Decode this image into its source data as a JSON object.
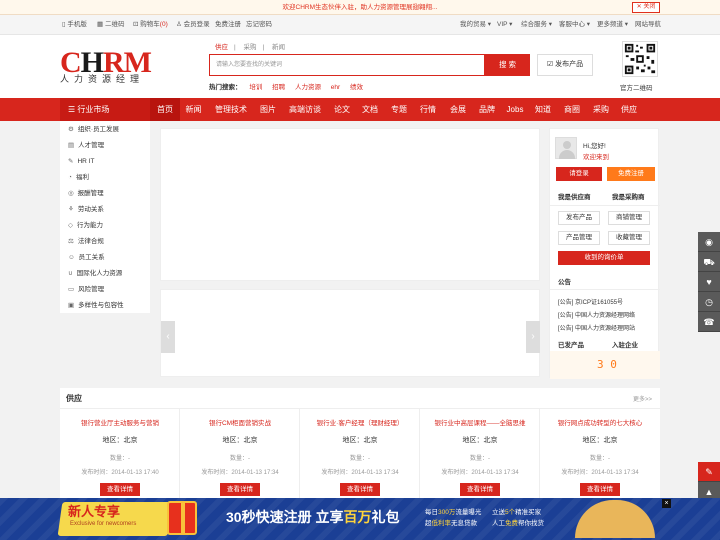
{
  "notice": {
    "text": "欢迎CHRM生态伙伴入驻，助人力资源管理展翅翱翔...",
    "close": "关闭"
  },
  "toolbar": {
    "left": [
      "手机版",
      "二维码",
      "购物车",
      "0",
      "会员登录",
      "免费注册",
      "忘记密码"
    ],
    "right": [
      "我的贸易 ▾",
      "VIP ▾",
      "综合服务 ▾",
      "客服中心 ▾",
      "更多频道 ▾",
      "网站导航"
    ]
  },
  "logo": {
    "big1": "C",
    "big2": "H",
    "big3": "RM",
    "sub": "人力资源经理"
  },
  "search": {
    "tabs": [
      "供应",
      "采购",
      "新闻"
    ],
    "placeholder": "请输入您要查找的关键词",
    "button": "搜 索",
    "publish": "发布产品",
    "hot_label": "热门搜索：",
    "hot": [
      "培训",
      "招聘",
      "人力资源",
      "ehr",
      "绩效"
    ]
  },
  "qr_label": "官方二维码",
  "nav": {
    "market": "行业市场",
    "items": [
      "首页",
      "新闻",
      "管理技术",
      "图片",
      "高端访谈",
      "论文",
      "文档",
      "专题",
      "行情",
      "会展",
      "品牌",
      "Jobs",
      "知道",
      "商圈",
      "采购",
      "供应"
    ]
  },
  "sidebar": [
    {
      "icon": "⚙",
      "label": "组织·员工发展"
    },
    {
      "icon": "▤",
      "label": "人才管理"
    },
    {
      "icon": "✎",
      "label": "HR IT"
    },
    {
      "icon": "◔",
      "label": "福利"
    },
    {
      "icon": "◎",
      "label": "报酬管理"
    },
    {
      "icon": "⚘",
      "label": "劳动关系"
    },
    {
      "icon": "◇",
      "label": "行为能力"
    },
    {
      "icon": "⚖",
      "label": "法律合规"
    },
    {
      "icon": "☺",
      "label": "员工关系"
    },
    {
      "icon": "∪",
      "label": "国际化人力资源"
    },
    {
      "icon": "▭",
      "label": "风险管理"
    },
    {
      "icon": "▣",
      "label": "多样性与包容性"
    }
  ],
  "user": {
    "hello": "Hi,您好!",
    "welcome": "欢迎来到",
    "login": "请登录",
    "register": "免费注册",
    "tab_seller": "我是供应商",
    "tab_buyer": "我是采购商",
    "btn1": "发布产品",
    "btn2": "商铺管理",
    "btn3": "产品管理",
    "btn4": "收藏管理",
    "inquiry": "收到的询价单",
    "notice_title": "公告",
    "notices": [
      "[公告] 京ICP证161055号",
      "[公告] 中国人力资源经理网络",
      "[公告] 中国人力资源经理网站"
    ],
    "stat1": "已发产品",
    "stat2": "入驻企业",
    "count": "3 0"
  },
  "supply": {
    "title": "供应",
    "more": "更多>>",
    "items": [
      {
        "title": "银行营业厅主动服务与营销",
        "area": "地区：北京",
        "qty": "数量：-",
        "date": "发布时间：2014-01-13 17:40",
        "btn": "查看详情"
      },
      {
        "title": "银行CM柜面营销实战",
        "area": "地区：北京",
        "qty": "数量：-",
        "date": "发布时间：2014-01-13 17:34",
        "btn": "查看详情"
      },
      {
        "title": "银行业·客户经理（理财经理）",
        "area": "地区：北京",
        "qty": "数量：-",
        "date": "发布时间：2014-01-13 17:34",
        "btn": "查看详情"
      },
      {
        "title": "银行业中高层课程——全脑思维",
        "area": "地区：北京",
        "qty": "数量：-",
        "date": "发布时间：2014-01-13 17:34",
        "btn": "查看详情"
      },
      {
        "title": "银行网点成功转型的七大核心",
        "area": "地区：北京",
        "qty": "数量：-",
        "date": "发布时间：2014-01-13 17:34",
        "btn": "查看详情"
      }
    ]
  },
  "promo": {
    "newcomer": "新人专享",
    "newcomer_sub": "Exclusive for newcomers",
    "headline1": "30秒快速注册 立享",
    "headline2": "百万",
    "headline3": "礼包",
    "line1a": "每日",
    "line1b": "300万",
    "line1c": "流量曝光",
    "line2a": "超",
    "line2b": "低利率",
    "line2c": "无息贷款",
    "line3a": "立送",
    "line3b": "5个",
    "line3c": "精准买家",
    "line4a": "人工",
    "line4b": "免费",
    "line4c": "帮你找货",
    "close": "×"
  },
  "colors": {
    "brand": "#d7261d",
    "navy": "#1b3f95",
    "orange": "#ff7a1a"
  }
}
